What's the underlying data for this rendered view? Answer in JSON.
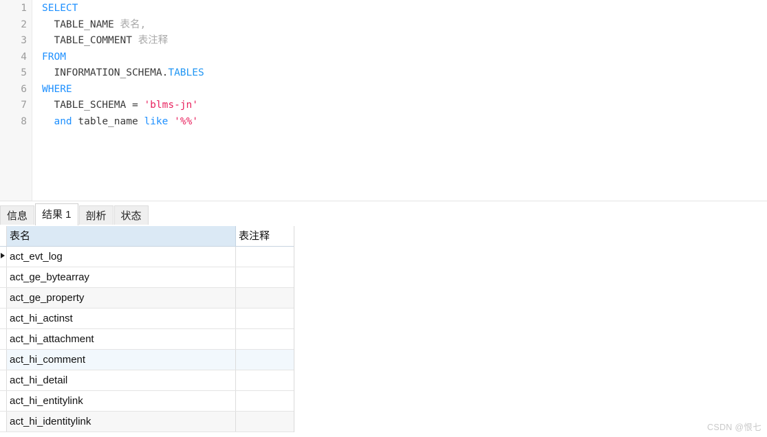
{
  "editor": {
    "line_numbers": [
      "1",
      "2",
      "3",
      "4",
      "5",
      "6",
      "7",
      "8"
    ],
    "lines": [
      {
        "n": "1",
        "tokens": [
          {
            "t": "SELECT",
            "k": "kw"
          }
        ]
      },
      {
        "n": "2",
        "tokens": [
          {
            "t": "  ",
            "k": "op"
          },
          {
            "t": "TABLE_NAME",
            "k": "ident"
          },
          {
            "t": " ",
            "k": "op"
          },
          {
            "t": "表名,",
            "k": "alias"
          }
        ]
      },
      {
        "n": "3",
        "tokens": [
          {
            "t": "  ",
            "k": "op"
          },
          {
            "t": "TABLE_COMMENT",
            "k": "ident"
          },
          {
            "t": " ",
            "k": "op"
          },
          {
            "t": "表注释",
            "k": "alias"
          }
        ]
      },
      {
        "n": "4",
        "tokens": [
          {
            "t": "FROM",
            "k": "kw"
          }
        ]
      },
      {
        "n": "5",
        "tokens": [
          {
            "t": "  ",
            "k": "op"
          },
          {
            "t": "INFORMATION_SCHEMA.",
            "k": "ident"
          },
          {
            "t": "TABLES",
            "k": "kw2"
          }
        ]
      },
      {
        "n": "6",
        "tokens": [
          {
            "t": "WHERE",
            "k": "kw"
          }
        ]
      },
      {
        "n": "7",
        "tokens": [
          {
            "t": "  ",
            "k": "op"
          },
          {
            "t": "TABLE_SCHEMA",
            "k": "ident"
          },
          {
            "t": " = ",
            "k": "op"
          },
          {
            "t": "'blms-jn'",
            "k": "str"
          }
        ]
      },
      {
        "n": "8",
        "tokens": [
          {
            "t": "  ",
            "k": "op"
          },
          {
            "t": "and",
            "k": "kw"
          },
          {
            "t": " ",
            "k": "op"
          },
          {
            "t": "table_name",
            "k": "ident"
          },
          {
            "t": " ",
            "k": "op"
          },
          {
            "t": "like",
            "k": "kw"
          },
          {
            "t": " ",
            "k": "op"
          },
          {
            "t": "'%%'",
            "k": "str"
          }
        ]
      }
    ],
    "sql_text": "SELECT\n  TABLE_NAME 表名,\n  TABLE_COMMENT 表注释\nFROM\n  INFORMATION_SCHEMA.TABLES\nWHERE\n  TABLE_SCHEMA = 'blms-jn'\n  and table_name like '%%'"
  },
  "tabs": [
    {
      "label": "信息",
      "active": false
    },
    {
      "label": "结果 1",
      "active": true
    },
    {
      "label": "剖析",
      "active": false
    },
    {
      "label": "状态",
      "active": false
    }
  ],
  "result_grid": {
    "columns": [
      "表名",
      "表注释"
    ],
    "rows": [
      {
        "cells": [
          "act_evt_log",
          ""
        ],
        "tint": "white",
        "current": true
      },
      {
        "cells": [
          "act_ge_bytearray",
          ""
        ],
        "tint": "white",
        "current": false
      },
      {
        "cells": [
          "act_ge_property",
          ""
        ],
        "tint": "gray",
        "current": false
      },
      {
        "cells": [
          "act_hi_actinst",
          ""
        ],
        "tint": "white",
        "current": false
      },
      {
        "cells": [
          "act_hi_attachment",
          ""
        ],
        "tint": "white",
        "current": false
      },
      {
        "cells": [
          "act_hi_comment",
          ""
        ],
        "tint": "blue",
        "current": false
      },
      {
        "cells": [
          "act_hi_detail",
          ""
        ],
        "tint": "white",
        "current": false
      },
      {
        "cells": [
          "act_hi_entitylink",
          ""
        ],
        "tint": "white",
        "current": false
      },
      {
        "cells": [
          "act_hi_identitylink",
          ""
        ],
        "tint": "gray",
        "current": false
      }
    ]
  },
  "watermark": {
    "text": "CSDN @恨七"
  },
  "colors": {
    "keyword": "#1e90ff",
    "string": "#e8225e",
    "identifier": "#3a3a3a",
    "alias": "#a8a8a8",
    "header_background": "#dbe9f5",
    "row_gray": "#f7f7f7",
    "row_blue": "#f2f8fd",
    "gutter_background": "#f7f7f7",
    "gutter_text": "#9b9b9b"
  }
}
